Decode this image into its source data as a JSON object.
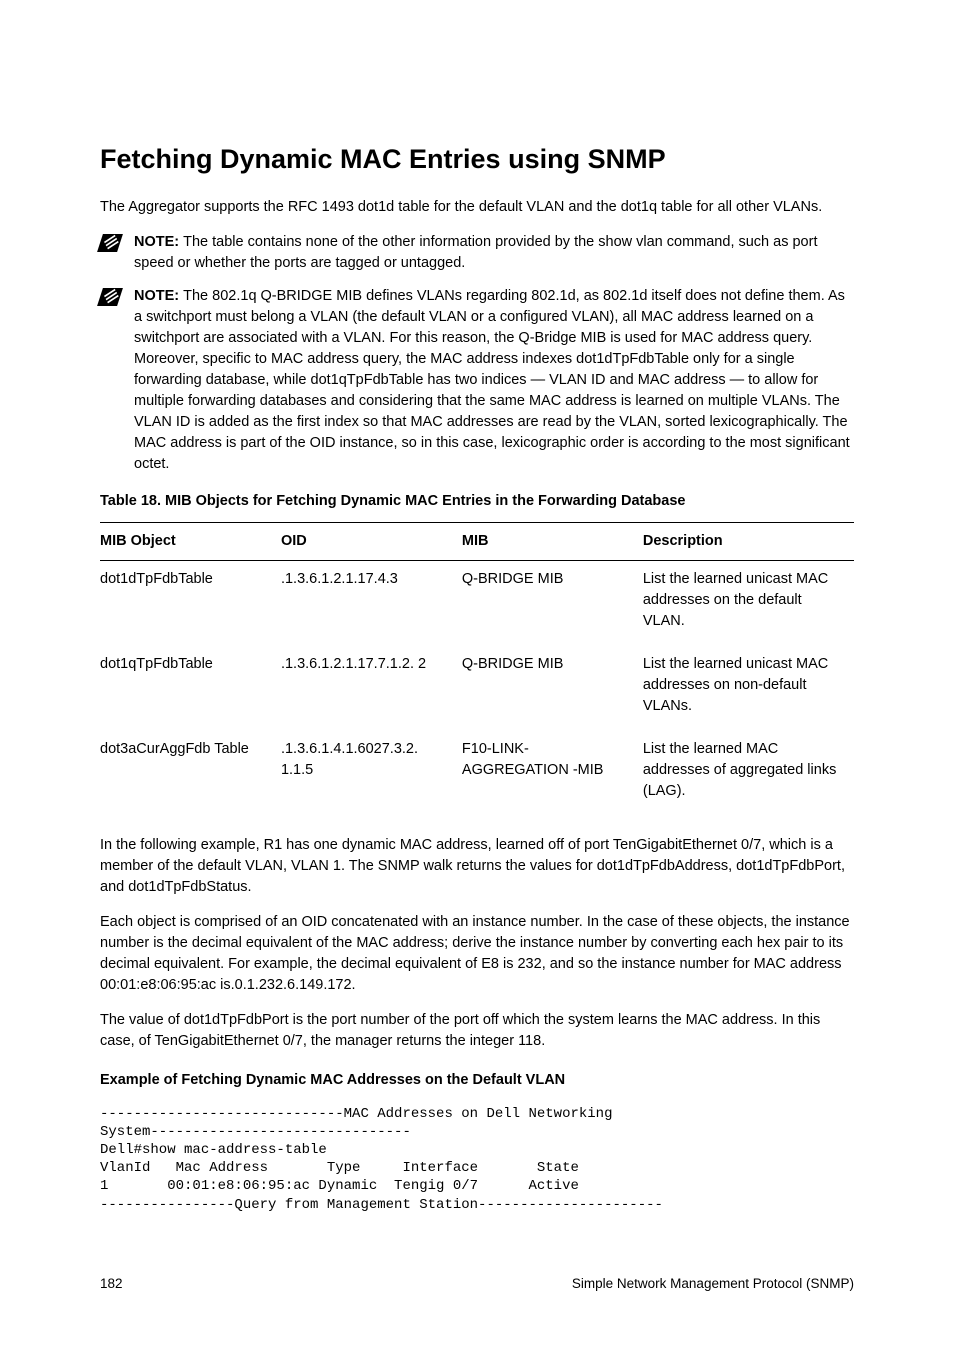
{
  "heading": "Fetching Dynamic MAC Entries using SNMP",
  "intro": "The Aggregator supports the RFC 1493 dot1d table for the default VLAN and the dot1q table for all other VLANs.",
  "note1": {
    "prefix": "NOTE: ",
    "text": "The table contains none of the other information provided by the show vlan command, such as port speed or whether the ports are tagged or untagged."
  },
  "note2": {
    "prefix": "NOTE: ",
    "text": "The 802.1q Q-BRIDGE MIB defines VLANs regarding 802.1d, as 802.1d itself does not define them. As a switchport must belong a VLAN (the default VLAN or a configured VLAN), all MAC address learned on a switchport are associated with a VLAN. For this reason, the Q-Bridge MIB is used for MAC address query. Moreover, specific to MAC address query, the MAC address indexes dot1dTpFdbTable only for a single forwarding database, while dot1qTpFdbTable has two indices — VLAN ID and MAC address — to allow for multiple forwarding databases and considering that the same MAC address is learned on multiple VLANs. The VLAN ID is added as the first index so that MAC addresses are read by the VLAN, sorted lexicographically. The MAC address is part of the OID instance, so in this case, lexicographic order is according to the most significant octet."
  },
  "table": {
    "caption": "Table 18. MIB Objects for Fetching Dynamic MAC Entries in the Forwarding Database",
    "headers": [
      "MIB Object",
      "OID",
      "MIB",
      "Description"
    ],
    "rows": [
      {
        "obj": "dot1dTpFdbTable",
        "oid": ".1.3.6.1.2.1.17.4.3",
        "mib": "Q-BRIDGE MIB",
        "desc": "List the learned unicast MAC addresses on the default VLAN."
      },
      {
        "obj": "dot1qTpFdbTable",
        "oid": ".1.3.6.1.2.1.17.7.1.2. 2",
        "mib": "Q-BRIDGE MIB",
        "desc": "List the learned unicast MAC addresses on non-default VLANs."
      },
      {
        "obj": "dot3aCurAggFdb Table",
        "oid": ".1.3.6.1.4.1.6027.3.2. 1.1.5",
        "mib": "F10-LINK-AGGREGATION -MIB",
        "desc": "List the learned MAC addresses of aggregated links (LAG)."
      }
    ]
  },
  "para1": "In the following example, R1 has one dynamic MAC address, learned off of port TenGigabitEthernet 0/7, which is a member of the default VLAN, VLAN 1. The SNMP walk returns the values for dot1dTpFdbAddress, dot1dTpFdbPort, and dot1dTpFdbStatus.",
  "para2": "Each object is comprised of an OID concatenated with an instance number. In the case of these objects, the instance number is the decimal equivalent of the MAC address; derive the instance number by converting each hex pair to its decimal equivalent. For example, the decimal equivalent of E8 is 232, and so the instance number for MAC address 00:01:e8:06:95:ac is.0.1.232.6.149.172.",
  "para3": "The value of dot1dTpFdbPort is the port number of the port off which the system learns the MAC address. In this case, of TenGigabitEthernet 0/7, the manager returns the integer 118.",
  "example_heading": "Example of Fetching Dynamic MAC Addresses on the Default VLAN",
  "code": "-----------------------------MAC Addresses on Dell Networking\nSystem-------------------------------\nDell#show mac-address-table\nVlanId   Mac Address       Type     Interface       State\n1       00:01:e8:06:95:ac Dynamic  Tengig 0/7      Active\n----------------Query from Management Station----------------------",
  "footer": {
    "page": "182",
    "chapter": "Simple Network Management Protocol (SNMP)"
  }
}
